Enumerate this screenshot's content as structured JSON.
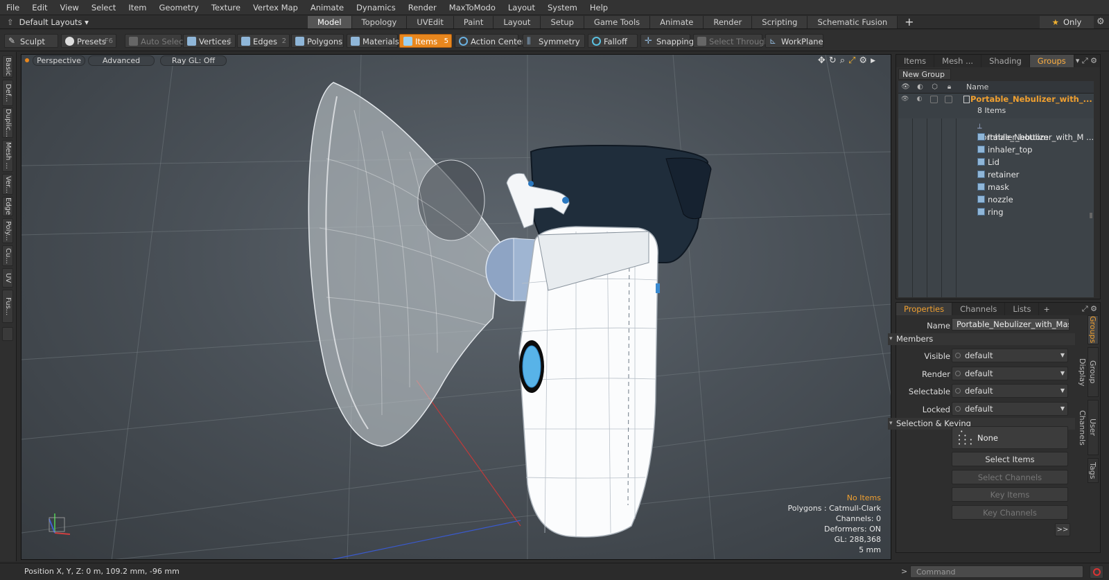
{
  "menu": [
    "File",
    "Edit",
    "View",
    "Select",
    "Item",
    "Geometry",
    "Texture",
    "Vertex Map",
    "Animate",
    "Dynamics",
    "Render",
    "MaxToModo",
    "Layout",
    "System",
    "Help"
  ],
  "layout_selector": "Default Layouts",
  "layout_tabs": [
    "Model",
    "Topology",
    "UVEdit",
    "Paint",
    "Layout",
    "Setup",
    "Game Tools",
    "Animate",
    "Render",
    "Scripting",
    "Schematic Fusion"
  ],
  "layout_tab_active": "Model",
  "only_label": "Only",
  "toolbar": {
    "sculpt": "Sculpt",
    "presets": "Presets",
    "presets_key": "F6",
    "auto_select": "Auto Select",
    "vertices": "Vertices",
    "vertices_key": "1",
    "edges": "Edges",
    "edges_key": "2",
    "polygons": "Polygons",
    "materials": "Materials",
    "items": "Items",
    "items_key": "5",
    "action_center": "Action Center",
    "symmetry": "Symmetry",
    "falloff": "Falloff",
    "snapping": "Snapping",
    "select_through": "Select Through",
    "workplane": "WorkPlane"
  },
  "left_tabs": [
    "Basic",
    "Def...",
    "Duplic...",
    "Mesh ...",
    "Ver...",
    "Edge",
    "Poly...",
    "Cu...",
    "UV",
    "Fus..."
  ],
  "viewport": {
    "view_mode": "Perspective",
    "shading": "Advanced",
    "raygl": "Ray GL: Off",
    "info": {
      "no_items": "No Items",
      "polygons": "Polygons : Catmull-Clark",
      "channels": "Channels: 0",
      "deformers": "Deformers: ON",
      "gl": "GL: 288,368",
      "scale": "5 mm"
    }
  },
  "top_panel": {
    "tabs": [
      "Items",
      "Mesh ...",
      "Shading",
      "Groups"
    ],
    "active_tab": "Groups",
    "new_group": "New Group",
    "name_header": "Name",
    "group_name": "Portable_Nebulizer_with_...",
    "group_count": "8 Items",
    "items": [
      {
        "name": "Portable_Nebulizer_with_M ...",
        "kind": "locator"
      },
      {
        "name": "Inhaler_bottom",
        "kind": "mesh"
      },
      {
        "name": "inhaler_top",
        "kind": "mesh"
      },
      {
        "name": "Lid",
        "kind": "mesh"
      },
      {
        "name": "retainer",
        "kind": "mesh"
      },
      {
        "name": "mask",
        "kind": "mesh"
      },
      {
        "name": "nozzle",
        "kind": "mesh"
      },
      {
        "name": "ring",
        "kind": "mesh"
      }
    ]
  },
  "properties": {
    "tabs": [
      "Properties",
      "Channels",
      "Lists"
    ],
    "active_tab": "Properties",
    "name_label": "Name",
    "name_value": "Portable_Nebulizer_with_Mask_Ir",
    "members_label": "Members",
    "visible_label": "Visible",
    "visible_value": "default",
    "render_label": "Render",
    "render_value": "default",
    "selectable_label": "Selectable",
    "selectable_value": "default",
    "locked_label": "Locked",
    "locked_value": "default",
    "selection_keying_label": "Selection & Keying",
    "none_label": "None",
    "select_items": "Select Items",
    "select_channels": "Select Channels",
    "key_items": "Key Items",
    "key_channels": "Key Channels",
    "more": ">>",
    "vertical_tabs": [
      "Groups",
      "Group Display",
      "User Channels",
      "Tags"
    ]
  },
  "status": {
    "position": "Position X, Y, Z:   0 m, 109.2 mm, -96 mm",
    "command_placeholder": "Command"
  },
  "colors": {
    "accent": "#e8871e",
    "panel": "#2e2e2e",
    "highlight_text": "#f0a030"
  }
}
